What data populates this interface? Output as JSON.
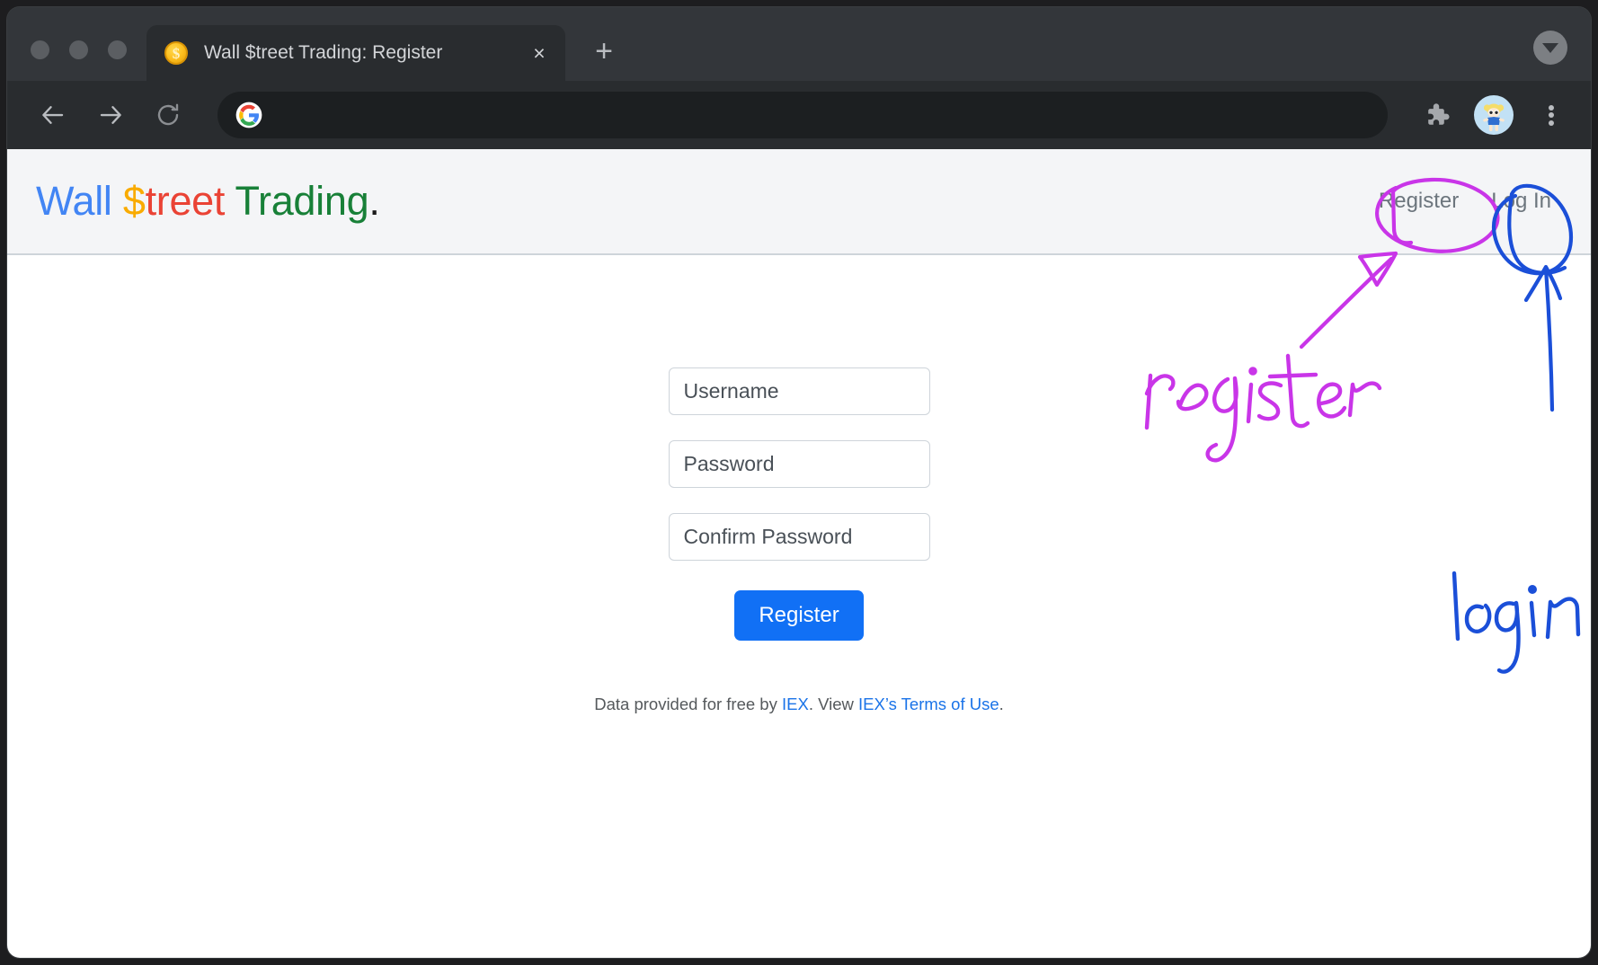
{
  "browser": {
    "tab": {
      "title": "Wall $treet Trading: Register",
      "favicon": "coin-dollar-icon",
      "close_label": "×"
    },
    "new_tab_label": "+",
    "omnibox": {
      "value": "",
      "placeholder": "",
      "icon": "google-g-icon"
    },
    "toolbar_icons": {
      "back": "back-arrow-icon",
      "forward": "forward-arrow-icon",
      "reload": "reload-icon",
      "extensions": "puzzle-piece-icon",
      "profile": "profile-avatar-icon",
      "menu": "three-dot-menu-icon",
      "window_menu": "chevron-down-icon"
    }
  },
  "site": {
    "logo": {
      "part1": "Wall ",
      "part2": "$",
      "part3": "treet ",
      "part4": "Trading",
      "part5": "."
    },
    "nav": {
      "register": "Register",
      "login": "Log In"
    }
  },
  "form": {
    "username_placeholder": "Username",
    "password_placeholder": "Password",
    "confirm_placeholder": "Confirm Password",
    "submit_label": "Register"
  },
  "footer": {
    "text_before": "Data provided for free by ",
    "link_iex": "IEX",
    "text_middle": ". View ",
    "link_terms": "IEX’s Terms of Use",
    "text_after": "."
  },
  "annotations": {
    "register_note": "register",
    "login_note": "login",
    "register_color": "#c935e8",
    "login_color": "#1b4fd8"
  },
  "colors": {
    "accent_blue": "#1170f5",
    "link_blue": "#1a73e8",
    "logo_blue": "#4285f4",
    "logo_yellow": "#f9ab00",
    "logo_red": "#ea4335",
    "logo_green": "#188038",
    "nav_gray": "#6c757d",
    "header_bg": "#f4f5f7"
  }
}
